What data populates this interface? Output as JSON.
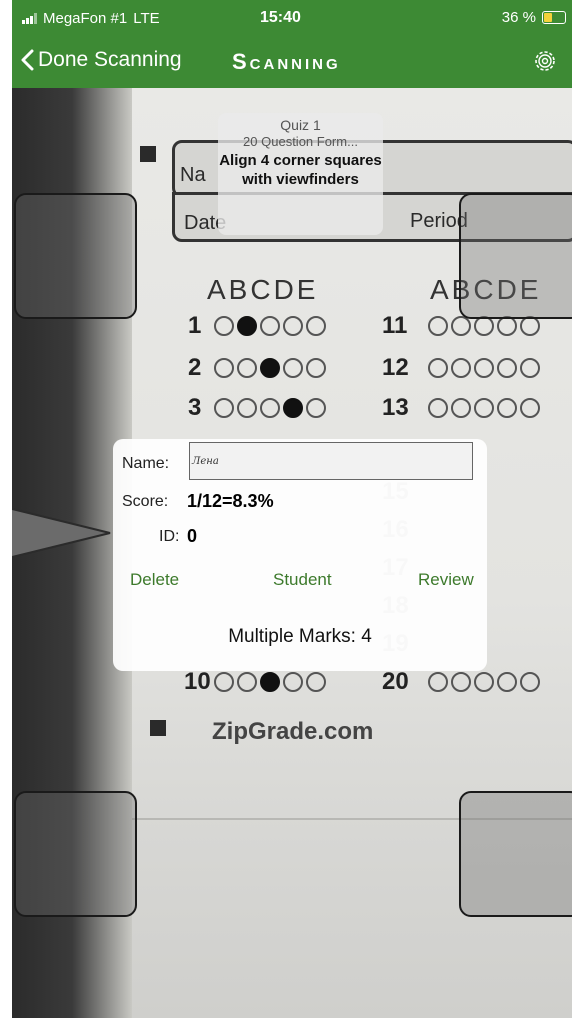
{
  "status_bar": {
    "carrier": "MegaFon #1",
    "network": "LTE",
    "time": "15:40",
    "battery": "36 %",
    "battery_level": 0.36
  },
  "nav_bar": {
    "back_label": "Done Scanning",
    "title": "Scanning",
    "settings_icon": "gear-icon"
  },
  "scan_overlay": {
    "quiz_name": "Quiz 1",
    "form_name": "20 Question Form...",
    "instruction": "Align 4 corner squares with viewfinders"
  },
  "answer_sheet": {
    "name_label": "Na",
    "date_label": "Date",
    "period_label": "Period",
    "letters_left": "ABCDE",
    "letters_right": "ABCDE",
    "rows_left": [
      "1",
      "2",
      "3"
    ],
    "rows_right": [
      "11",
      "12",
      "13"
    ],
    "rows_lower_left": [
      "10"
    ],
    "rows_lower_right": [
      "15",
      "16",
      "17",
      "18",
      "19",
      "20"
    ],
    "footer": "ZipGrade.com"
  },
  "result": {
    "name_label": "Name:",
    "name_value": "Лена",
    "score_label": "Score:",
    "score_value": "1/12=8.3%",
    "id_label": "ID:",
    "id_value": "0",
    "delete_label": "Delete",
    "student_label": "Student",
    "review_label": "Review",
    "multiple_marks": "Multiple Marks: 4"
  },
  "colors": {
    "header_green": "#3d8a34",
    "link_green": "#3d7a2c"
  }
}
